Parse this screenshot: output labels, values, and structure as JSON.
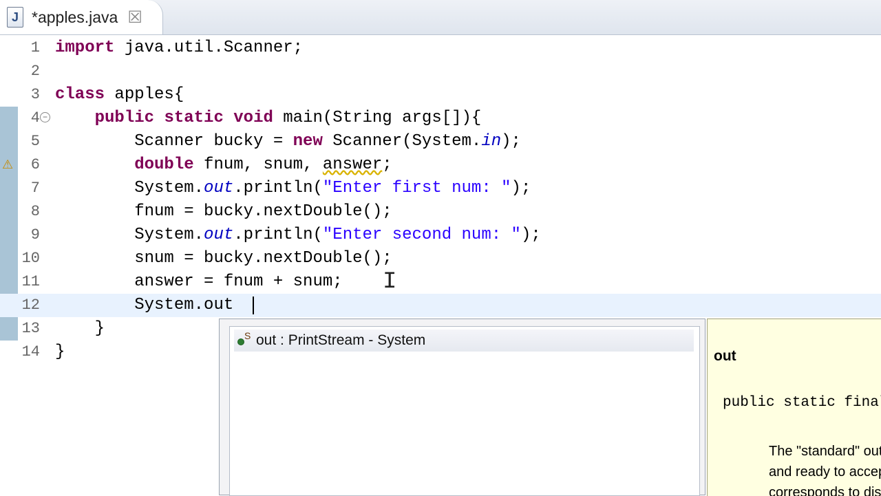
{
  "tab": {
    "icon_letter": "J",
    "title": "*apples.java",
    "close_symbol": "☒"
  },
  "editor": {
    "line_numbers": [
      "1",
      "2",
      "3",
      "4",
      "5",
      "6",
      "7",
      "8",
      "9",
      "10",
      "11",
      "12",
      "13",
      "14"
    ],
    "lines": [
      {
        "parts": [
          {
            "t": "import",
            "c": "kw"
          },
          {
            "t": " java.util.Scanner;"
          }
        ]
      },
      {
        "parts": []
      },
      {
        "parts": [
          {
            "t": "class",
            "c": "kw"
          },
          {
            "t": " apples{"
          }
        ]
      },
      {
        "parts": [
          {
            "t": "    "
          },
          {
            "t": "public",
            "c": "kw"
          },
          {
            "t": " "
          },
          {
            "t": "static",
            "c": "kw"
          },
          {
            "t": " "
          },
          {
            "t": "void",
            "c": "kw"
          },
          {
            "t": " main(String args[]){"
          }
        ]
      },
      {
        "parts": [
          {
            "t": "        Scanner bucky = "
          },
          {
            "t": "new",
            "c": "kw"
          },
          {
            "t": " Scanner(System."
          },
          {
            "t": "in",
            "c": "fld"
          },
          {
            "t": ");"
          }
        ]
      },
      {
        "parts": [
          {
            "t": "        "
          },
          {
            "t": "double",
            "c": "kw"
          },
          {
            "t": " fnum, snum, "
          },
          {
            "t": "answer",
            "c": "warn-underline"
          },
          {
            "t": ";"
          }
        ]
      },
      {
        "parts": [
          {
            "t": "        System."
          },
          {
            "t": "out",
            "c": "fld"
          },
          {
            "t": ".println("
          },
          {
            "t": "\"Enter first num: \"",
            "c": "str"
          },
          {
            "t": ");"
          }
        ]
      },
      {
        "parts": [
          {
            "t": "        fnum = bucky.nextDouble();"
          }
        ]
      },
      {
        "parts": [
          {
            "t": "        System."
          },
          {
            "t": "out",
            "c": "fld"
          },
          {
            "t": ".println("
          },
          {
            "t": "\"Enter second num: \"",
            "c": "str"
          },
          {
            "t": ");"
          }
        ]
      },
      {
        "parts": [
          {
            "t": "        snum = bucky.nextDouble();"
          }
        ]
      },
      {
        "parts": [
          {
            "t": "        answer = fnum + snum;"
          }
        ]
      },
      {
        "parts": [
          {
            "t": "        System.out"
          }
        ]
      },
      {
        "parts": [
          {
            "t": "    }"
          }
        ]
      },
      {
        "parts": [
          {
            "t": "}"
          }
        ]
      }
    ]
  },
  "content_assist": {
    "items": [
      {
        "label": "out : PrintStream - System",
        "icon": "static-field-icon",
        "icon_superscript": "S"
      }
    ]
  },
  "javadoc": {
    "name": "out",
    "signature": "public static final PrintStream out",
    "description_lines": [
      "The \"standard\" output stream. This stream is already open",
      "and ready to accept output data. Typically this stream",
      "corresponds to display output"
    ]
  }
}
